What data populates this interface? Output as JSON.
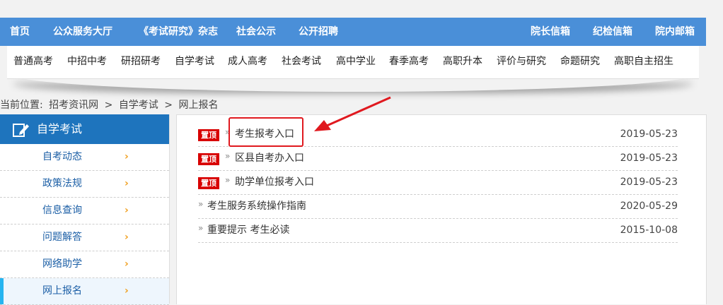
{
  "topnav": {
    "left": [
      "首页",
      "公众服务大厅",
      "《考试研究》杂志",
      "社会公示",
      "公开招聘"
    ],
    "right": [
      "院长信箱",
      "纪检信箱",
      "院内邮箱"
    ]
  },
  "subnav": [
    "普通高考",
    "中招中考",
    "研招研考",
    "自学考试",
    "成人高考",
    "社会考试",
    "高中学业",
    "春季高考",
    "高职升本",
    "评价与研究",
    "命题研究",
    "高职自主招生"
  ],
  "breadcrumb": [
    "当前位置:",
    "招考资讯网",
    ">",
    "自学考试",
    ">",
    "网上报名"
  ],
  "sidebar": {
    "title": "自学考试",
    "items": [
      {
        "label": "自考动态"
      },
      {
        "label": "政策法规"
      },
      {
        "label": "信息查询"
      },
      {
        "label": "问题解答"
      },
      {
        "label": "网络助学"
      },
      {
        "label": "网上报名",
        "active": true
      }
    ],
    "chevron": "›"
  },
  "main": {
    "badge": "置顶",
    "arrow": "»",
    "rows": [
      {
        "pinned": true,
        "title": "考生报考入口",
        "date": "2019-05-23"
      },
      {
        "pinned": true,
        "title": "区县自考办入口",
        "date": "2019-05-23"
      },
      {
        "pinned": true,
        "title": "助学单位报考入口",
        "date": "2019-05-23"
      },
      {
        "pinned": false,
        "title": "考生服务系统操作指南",
        "date": "2020-05-29"
      },
      {
        "pinned": false,
        "title": "重要提示 考生必读",
        "date": "2015-10-08"
      }
    ]
  },
  "colors": {
    "topnav_bg": "#4a8fd8",
    "sidebar_header": "#1e74bd",
    "badge": "#d80000",
    "annotation": "#e0191f",
    "chevron": "#f0a020"
  }
}
